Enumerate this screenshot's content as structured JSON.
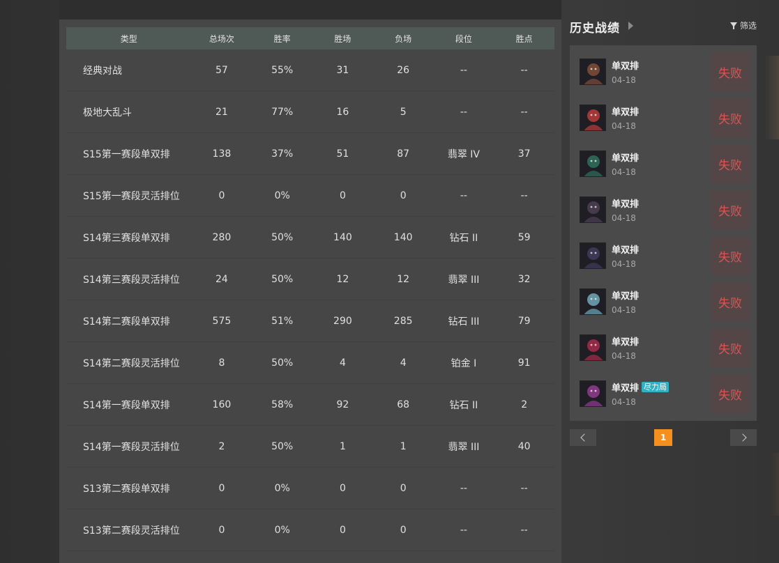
{
  "stats_table": {
    "headers": [
      "类型",
      "总场次",
      "胜率",
      "胜场",
      "负场",
      "段位",
      "胜点"
    ],
    "rows": [
      {
        "type": "经典对战",
        "total": "57",
        "winrate": "55%",
        "wins": "31",
        "losses": "26",
        "rank": "--",
        "lp": "--"
      },
      {
        "type": "极地大乱斗",
        "total": "21",
        "winrate": "77%",
        "wins": "16",
        "losses": "5",
        "rank": "--",
        "lp": "--"
      },
      {
        "type": "S15第一赛段单双排",
        "total": "138",
        "winrate": "37%",
        "wins": "51",
        "losses": "87",
        "rank": "翡翠 IV",
        "lp": "37"
      },
      {
        "type": "S15第一赛段灵活排位",
        "total": "0",
        "winrate": "0%",
        "wins": "0",
        "losses": "0",
        "rank": "--",
        "lp": "--"
      },
      {
        "type": "S14第三赛段单双排",
        "total": "280",
        "winrate": "50%",
        "wins": "140",
        "losses": "140",
        "rank": "钻石 II",
        "lp": "59"
      },
      {
        "type": "S14第三赛段灵活排位",
        "total": "24",
        "winrate": "50%",
        "wins": "12",
        "losses": "12",
        "rank": "翡翠 III",
        "lp": "32"
      },
      {
        "type": "S14第二赛段单双排",
        "total": "575",
        "winrate": "51%",
        "wins": "290",
        "losses": "285",
        "rank": "钻石 III",
        "lp": "79"
      },
      {
        "type": "S14第二赛段灵活排位",
        "total": "8",
        "winrate": "50%",
        "wins": "4",
        "losses": "4",
        "rank": "铂金 I",
        "lp": "91"
      },
      {
        "type": "S14第一赛段单双排",
        "total": "160",
        "winrate": "58%",
        "wins": "92",
        "losses": "68",
        "rank": "钻石 II",
        "lp": "2"
      },
      {
        "type": "S14第一赛段灵活排位",
        "total": "2",
        "winrate": "50%",
        "wins": "1",
        "losses": "1",
        "rank": "翡翠 III",
        "lp": "40"
      },
      {
        "type": "S13第二赛段单双排",
        "total": "0",
        "winrate": "0%",
        "wins": "0",
        "losses": "0",
        "rank": "--",
        "lp": "--"
      },
      {
        "type": "S13第二赛段灵活排位",
        "total": "0",
        "winrate": "0%",
        "wins": "0",
        "losses": "0",
        "rank": "--",
        "lp": "--"
      }
    ]
  },
  "history": {
    "title": "历史战绩",
    "filter_label": "筛选",
    "matches": [
      {
        "mode": "单双排",
        "date": "04-18",
        "result": "失败",
        "tag": "",
        "avatar_color": "#7a4a3a"
      },
      {
        "mode": "单双排",
        "date": "04-18",
        "result": "失败",
        "tag": "",
        "avatar_color": "#b03a3a"
      },
      {
        "mode": "单双排",
        "date": "04-18",
        "result": "失败",
        "tag": "",
        "avatar_color": "#2f6a5a"
      },
      {
        "mode": "单双排",
        "date": "04-18",
        "result": "失败",
        "tag": "",
        "avatar_color": "#4a3e52"
      },
      {
        "mode": "单双排",
        "date": "04-18",
        "result": "失败",
        "tag": "",
        "avatar_color": "#3e3a5a"
      },
      {
        "mode": "单双排",
        "date": "04-18",
        "result": "失败",
        "tag": "",
        "avatar_color": "#6aa0b0"
      },
      {
        "mode": "单双排",
        "date": "04-18",
        "result": "失败",
        "tag": "",
        "avatar_color": "#a02a4a"
      },
      {
        "mode": "单双排",
        "date": "04-18",
        "result": "失败",
        "tag": "尽力局",
        "avatar_color": "#8a3a8a"
      }
    ]
  },
  "pagination": {
    "current_page": "1"
  }
}
